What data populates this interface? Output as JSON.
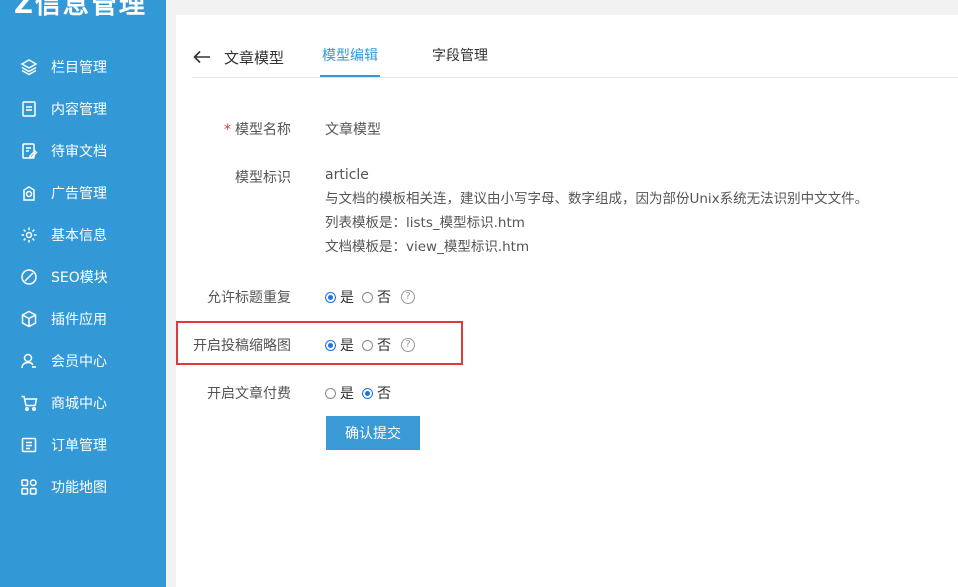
{
  "brand": "Z信息管理",
  "sidebar": {
    "items": [
      {
        "label": "栏目管理",
        "icon": "layers-icon"
      },
      {
        "label": "内容管理",
        "icon": "document-icon"
      },
      {
        "label": "待审文档",
        "icon": "edit-document-icon"
      },
      {
        "label": "广告管理",
        "icon": "ad-icon"
      },
      {
        "label": "基本信息",
        "icon": "gear-icon"
      },
      {
        "label": "SEO模块",
        "icon": "seo-icon"
      },
      {
        "label": "插件应用",
        "icon": "cube-icon"
      },
      {
        "label": "会员中心",
        "icon": "user-icon"
      },
      {
        "label": "商城中心",
        "icon": "cart-icon"
      },
      {
        "label": "订单管理",
        "icon": "order-list-icon"
      },
      {
        "label": "功能地图",
        "icon": "grid-icon"
      }
    ]
  },
  "tabs": {
    "back_label": "文章模型",
    "items": [
      {
        "label": "模型编辑",
        "active": true
      },
      {
        "label": "字段管理",
        "active": false
      }
    ]
  },
  "form": {
    "model_name": {
      "label": "模型名称",
      "value": "文章模型"
    },
    "model_id": {
      "label": "模型标识",
      "value": "article",
      "help": [
        "与文档的模板相关连，建议由小写字母、数字组成，因为部份Unix系统无法识别中文文件。",
        "列表模板是：lists_模型标识.htm",
        "文档模板是：view_模型标识.htm"
      ]
    },
    "allow_dup_title": {
      "label": "允许标题重复",
      "yes": "是",
      "no": "否",
      "selected": "yes"
    },
    "enable_thumb": {
      "label": "开启投稿缩略图",
      "yes": "是",
      "no": "否",
      "selected": "yes"
    },
    "enable_paid": {
      "label": "开启文章付费",
      "yes": "是",
      "no": "否",
      "selected": "no"
    },
    "submit_label": "确认提交"
  },
  "colors": {
    "sidebar": "#3399d6",
    "accent": "#3399d6",
    "highlight": "#e03a3a"
  }
}
